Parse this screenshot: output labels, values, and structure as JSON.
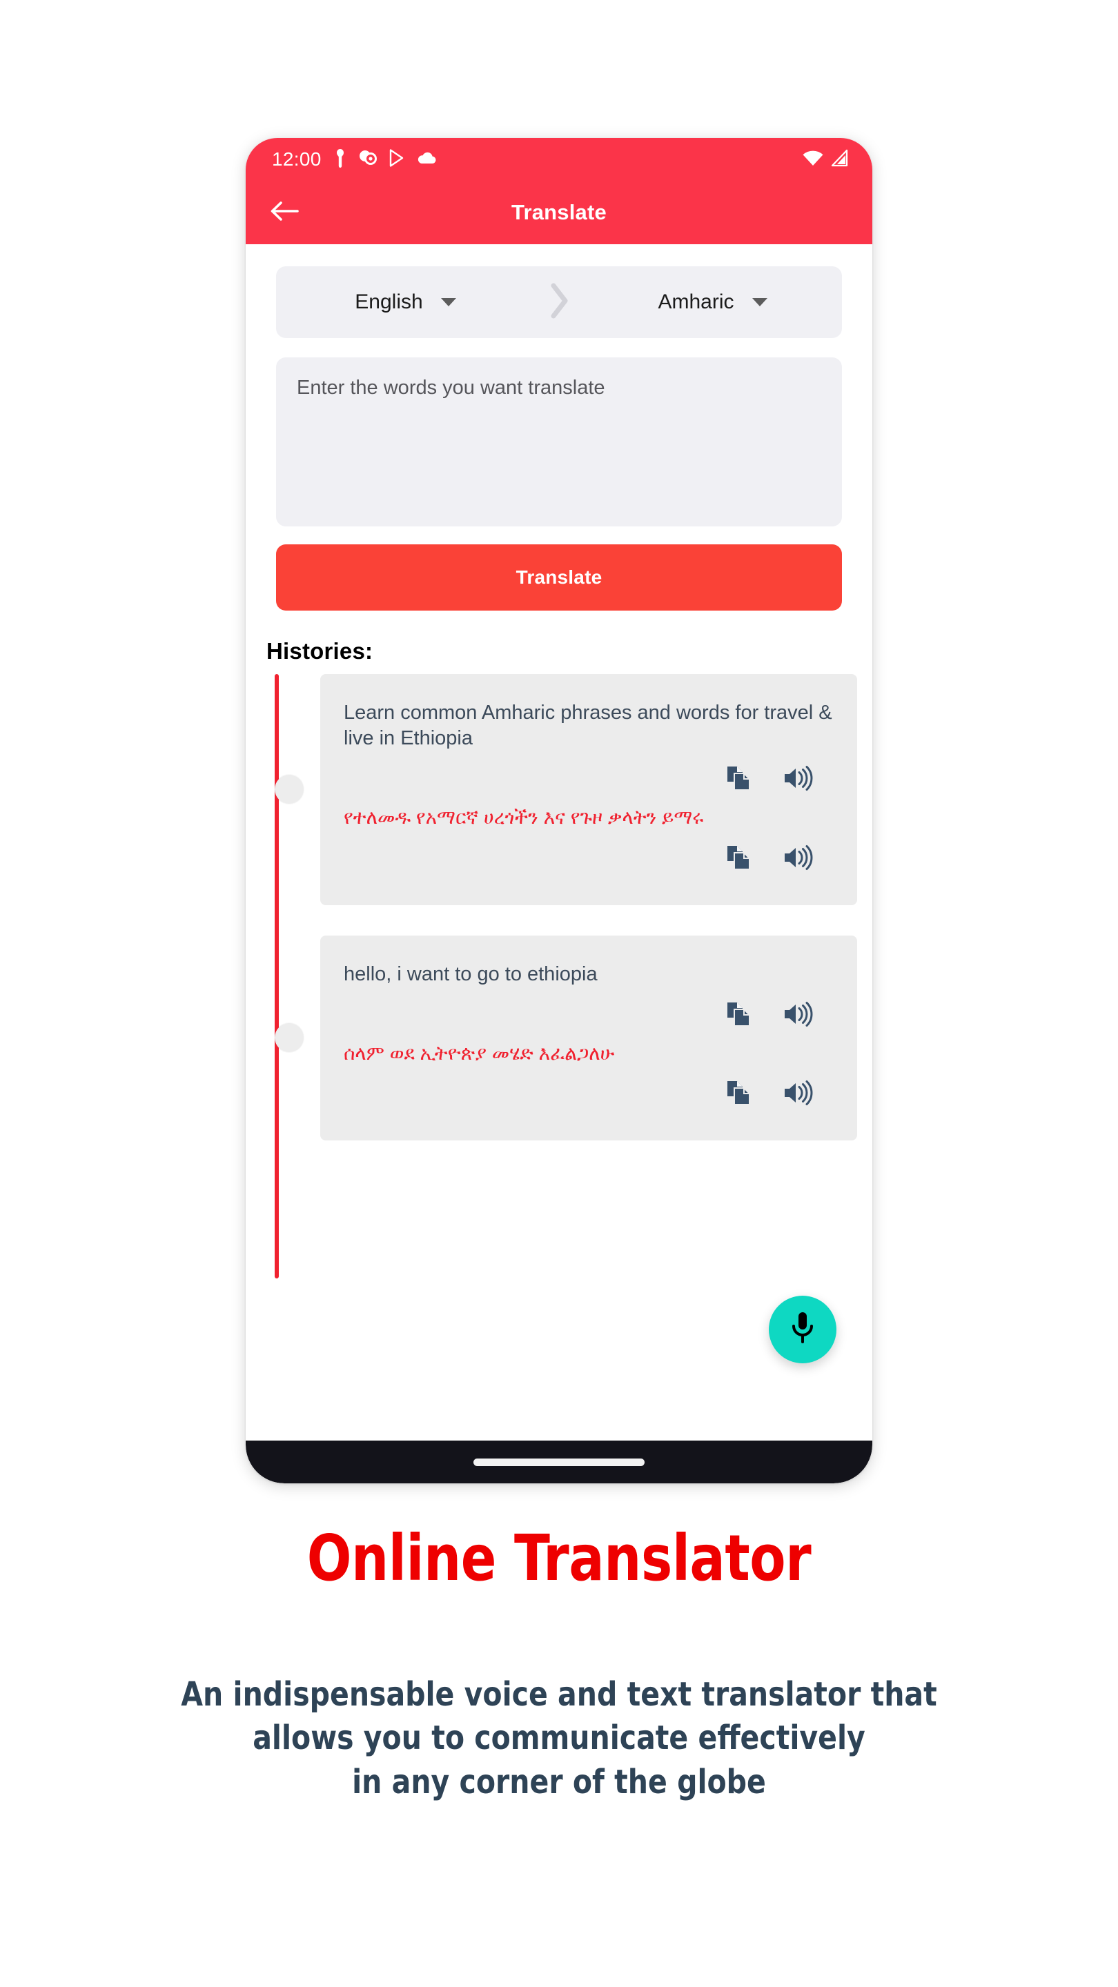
{
  "status_bar": {
    "time": "12:00",
    "left_icons": [
      "person-icon",
      "circle-badge-icon",
      "play-store-icon",
      "cloud-icon"
    ],
    "right_icons": [
      "wifi-icon",
      "signal-icon"
    ]
  },
  "app_bar": {
    "back_label": "back-arrow",
    "title": "Translate"
  },
  "language_selector": {
    "source": "English",
    "target": "Amharic",
    "arrow": "chevron-right-icon"
  },
  "input": {
    "value": "",
    "placeholder": "Enter the words you want translate"
  },
  "translate_button": {
    "label": "Translate"
  },
  "histories": {
    "label": "Histories:",
    "items": [
      {
        "source_text": "Learn common Amharic phrases and words for travel & live in Ethiopia",
        "target_text": "የተለመዱ የአማርኛ ሀረጎችን እና የጉዞ ቃላትን ይማሩ",
        "copy_label": "copy-icon",
        "speak_label": "speaker-icon"
      },
      {
        "source_text": "hello, i want to go to ethiopia",
        "target_text": "ሰላም ወደ ኢትዮጵያ መሄድ እፈልጋለሁ",
        "copy_label": "copy-icon",
        "speak_label": "speaker-icon"
      }
    ]
  },
  "mic_fab": {
    "label": "microphone-icon"
  },
  "nav_bar": {
    "home_indicator": "home-indicator"
  },
  "marketing": {
    "headline": "Online Translator",
    "subhead_line1": "An indispensable voice and text translator that",
    "subhead_line2": "allows you to communicate effectively",
    "subhead_line3": "in any corner of the globe"
  },
  "colors": {
    "header_red": "#FB3449",
    "button_red": "#FA4237",
    "timeline_red": "#F0212F",
    "headline_red": "#EE0000",
    "teal_fab": "#0ED8C2",
    "slate_text": "#2E4356",
    "card_gray": "#ECECEC",
    "field_gray": "#F0F0F4"
  }
}
